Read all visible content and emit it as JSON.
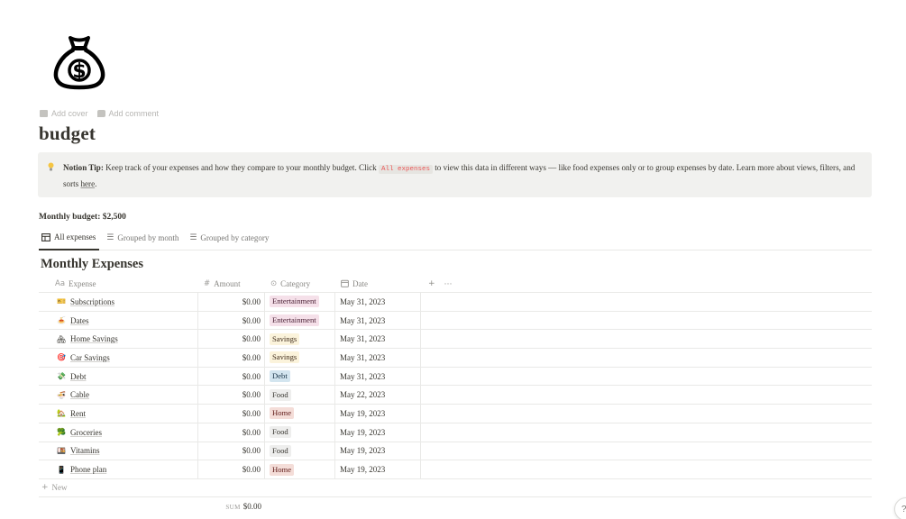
{
  "page": {
    "icon": "money-bag-icon",
    "add_cover": "Add cover",
    "add_comment": "Add comment",
    "title": "budget"
  },
  "callout": {
    "icon": "lightbulb-icon",
    "bold": "Notion Tip:",
    "text_before": " Keep track of your expenses and how they compare to your monthly budget. Click ",
    "code": "All expenses",
    "text_after": " to view this data in different ways — like food expenses only or to group expenses by date. Learn more about views, filters, and sorts ",
    "link": "here",
    "end": "."
  },
  "budget_line": "Monthly budget: $2,500",
  "tabs": [
    {
      "label": "All expenses",
      "icon": "table-icon",
      "active": true
    },
    {
      "label": "Grouped by month",
      "icon": "list-icon",
      "active": false
    },
    {
      "label": "Grouped by category",
      "icon": "list-icon",
      "active": false
    }
  ],
  "database": {
    "title": "Monthly Expenses",
    "columns": {
      "expense": "Expense",
      "amount": "Amount",
      "category": "Category",
      "date": "Date",
      "add": "+",
      "more": "···"
    },
    "rows": [
      {
        "emoji": "🎫",
        "expense": "Subscriptions",
        "amount": "$0.00",
        "category": "Entertainment",
        "date": "May 31, 2023"
      },
      {
        "emoji": "🍝",
        "expense": "Dates",
        "amount": "$0.00",
        "category": "Entertainment",
        "date": "May 31, 2023"
      },
      {
        "emoji": "🏘",
        "expense": "Home Savings",
        "amount": "$0.00",
        "category": "Savings",
        "date": "May 31, 2023"
      },
      {
        "emoji": "🎯",
        "expense": "Car Savings",
        "amount": "$0.00",
        "category": "Savings",
        "date": "May 31, 2023"
      },
      {
        "emoji": "💸",
        "expense": "Debt",
        "amount": "$0.00",
        "category": "Debt",
        "date": "May 31, 2023"
      },
      {
        "emoji": "🍜",
        "expense": "Cable",
        "amount": "$0.00",
        "category": "Food",
        "date": "May 22, 2023"
      },
      {
        "emoji": "🏡",
        "expense": "Rent",
        "amount": "$0.00",
        "category": "Home",
        "date": "May 19, 2023"
      },
      {
        "emoji": "🥦",
        "expense": "Groceries",
        "amount": "$0.00",
        "category": "Food",
        "date": "May 19, 2023"
      },
      {
        "emoji": "🍱",
        "expense": "Vitamins",
        "amount": "$0.00",
        "category": "Food",
        "date": "May 19, 2023"
      },
      {
        "emoji": "📱",
        "expense": "Phone plan",
        "amount": "$0.00",
        "category": "Home",
        "date": "May 19, 2023"
      }
    ],
    "new_label": "New",
    "sum_label": "SUM",
    "sum_value": "$0.00"
  },
  "category_colors": {
    "Entertainment": {
      "bg": "#f5e0e9",
      "fg": "#4c2337"
    },
    "Savings": {
      "bg": "#fbf3db",
      "fg": "#402c1b"
    },
    "Debt": {
      "bg": "#d3e5ef",
      "fg": "#183347"
    },
    "Food": {
      "bg": "#eeeeed",
      "fg": "#37352f"
    },
    "Home": {
      "bg": "#f4ddd8",
      "fg": "#5d1715"
    }
  },
  "help_button": "?"
}
